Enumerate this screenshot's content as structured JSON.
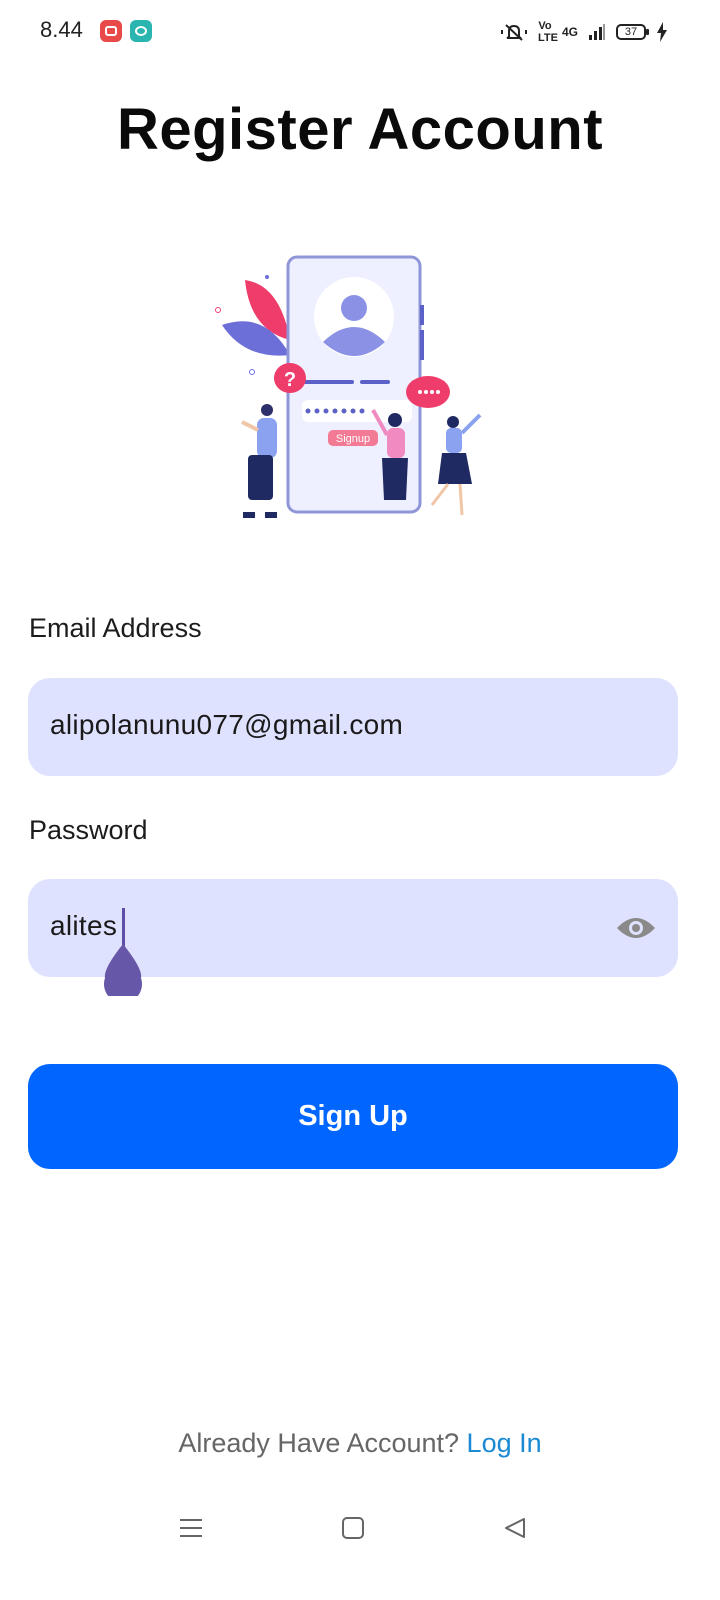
{
  "status_bar": {
    "time": "8.44",
    "network_label": "4G",
    "volte_label": "Vo LTE",
    "battery_level": "37",
    "icons": [
      "screen-recorder-icon",
      "messenger-icon",
      "mute-icon",
      "volte-icon",
      "signal-icon",
      "battery-icon",
      "charging-icon"
    ]
  },
  "page": {
    "title": "Register Account"
  },
  "illustration": {
    "signup_text": "Signup"
  },
  "form": {
    "email": {
      "label": "Email Address",
      "value": "alipolanunu077@gmail.com"
    },
    "password": {
      "label": "Password",
      "value": "alites"
    },
    "submit_label": "Sign Up"
  },
  "footer": {
    "prompt": "Already Have Account?",
    "link": "Log In"
  },
  "nav_bar": {
    "icons": [
      "menu-icon",
      "home-icon",
      "back-icon"
    ]
  },
  "colors": {
    "field_background": "#dfe2ff",
    "button_primary": "#0166ff",
    "link": "#1b8ad3",
    "caret": "#5d4ea7"
  }
}
